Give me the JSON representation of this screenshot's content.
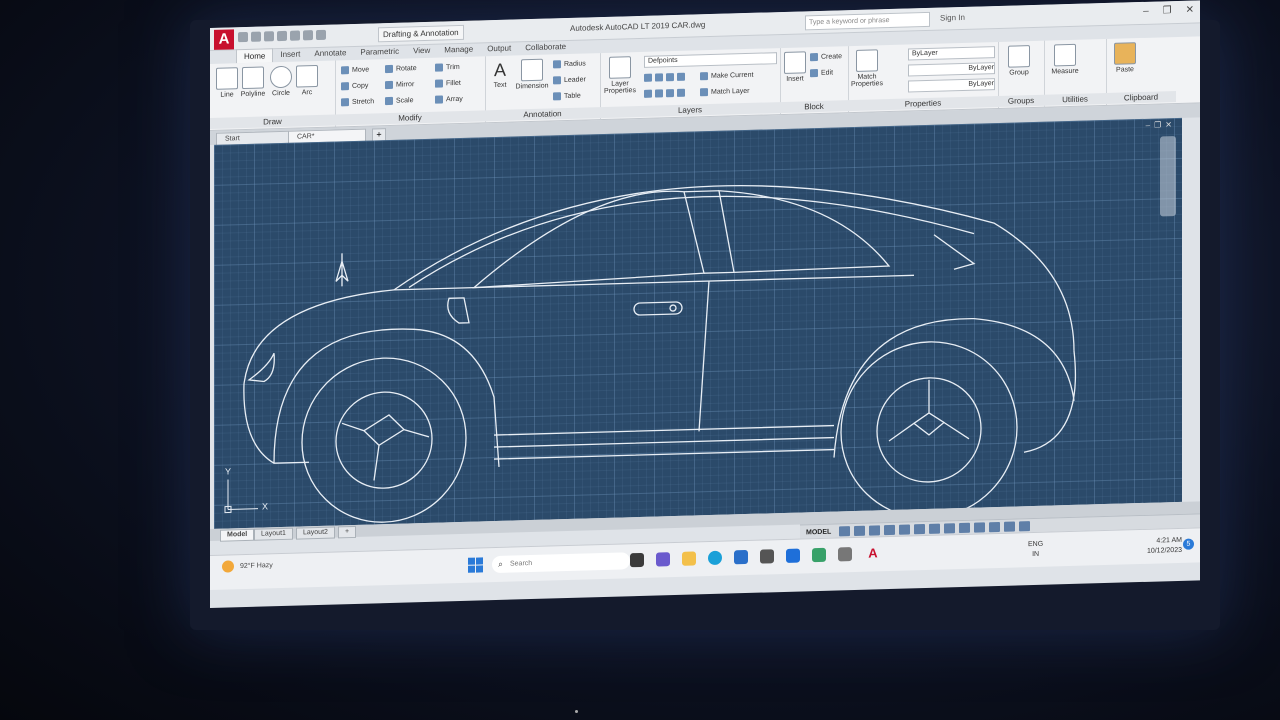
{
  "titlebar": {
    "app_icon": "A",
    "workspace": "Drafting & Annotation",
    "window_title": "Autodesk AutoCAD LT 2019    CAR.dwg",
    "search_placeholder": "Type a keyword or phrase",
    "signin": "Sign In"
  },
  "ribbon_tabs": [
    "Home",
    "Insert",
    "Annotate",
    "Parametric",
    "View",
    "Manage",
    "Output",
    "Collaborate"
  ],
  "draw": {
    "title": "Draw",
    "line": "Line",
    "polyline": "Polyline",
    "circle": "Circle",
    "arc": "Arc"
  },
  "modify": {
    "title": "Modify",
    "move": "Move",
    "rotate": "Rotate",
    "trim": "Trim",
    "copy": "Copy",
    "mirror": "Mirror",
    "fillet": "Fillet",
    "stretch": "Stretch",
    "scale": "Scale",
    "array": "Array"
  },
  "annotation": {
    "title": "Annotation",
    "text": "Text",
    "dimension": "Dimension",
    "radius": "Radius",
    "leader": "Leader",
    "table": "Table"
  },
  "layers": {
    "title": "Layers",
    "layer_properties": "Layer Properties",
    "current_layer": "Defpoints",
    "make_current": "Make Current",
    "match_layer": "Match Layer"
  },
  "block": {
    "title": "Block",
    "insert": "Insert",
    "create": "Create",
    "edit": "Edit"
  },
  "properties": {
    "title": "Properties",
    "match_properties": "Match Properties",
    "color": "ByLayer",
    "linetype": "ByLayer",
    "lineweight": "ByLayer"
  },
  "groups": {
    "title": "Groups",
    "group": "Group"
  },
  "utilities": {
    "title": "Utilities",
    "measure": "Measure"
  },
  "clipboard": {
    "title": "Clipboard",
    "paste": "Paste"
  },
  "doc_tabs": {
    "start": "Start",
    "car": "CAR*"
  },
  "ucs": {
    "x": "X",
    "y": "Y"
  },
  "layout_tabs": {
    "model": "Model",
    "layout1": "Layout1",
    "layout2": "Layout2"
  },
  "statusbar": {
    "model": "MODEL"
  },
  "taskbar": {
    "weather_temp": "92°F",
    "weather_desc": "Hazy",
    "search": "Search",
    "lang_top": "ENG",
    "lang_bottom": "IN",
    "time": "4:21 AM",
    "date": "10/12/2023",
    "notifications": "5"
  },
  "colors": {
    "canvas": "#2b4a6a",
    "autocad_red": "#c8102e",
    "accent_blue": "#2a7ad8"
  }
}
